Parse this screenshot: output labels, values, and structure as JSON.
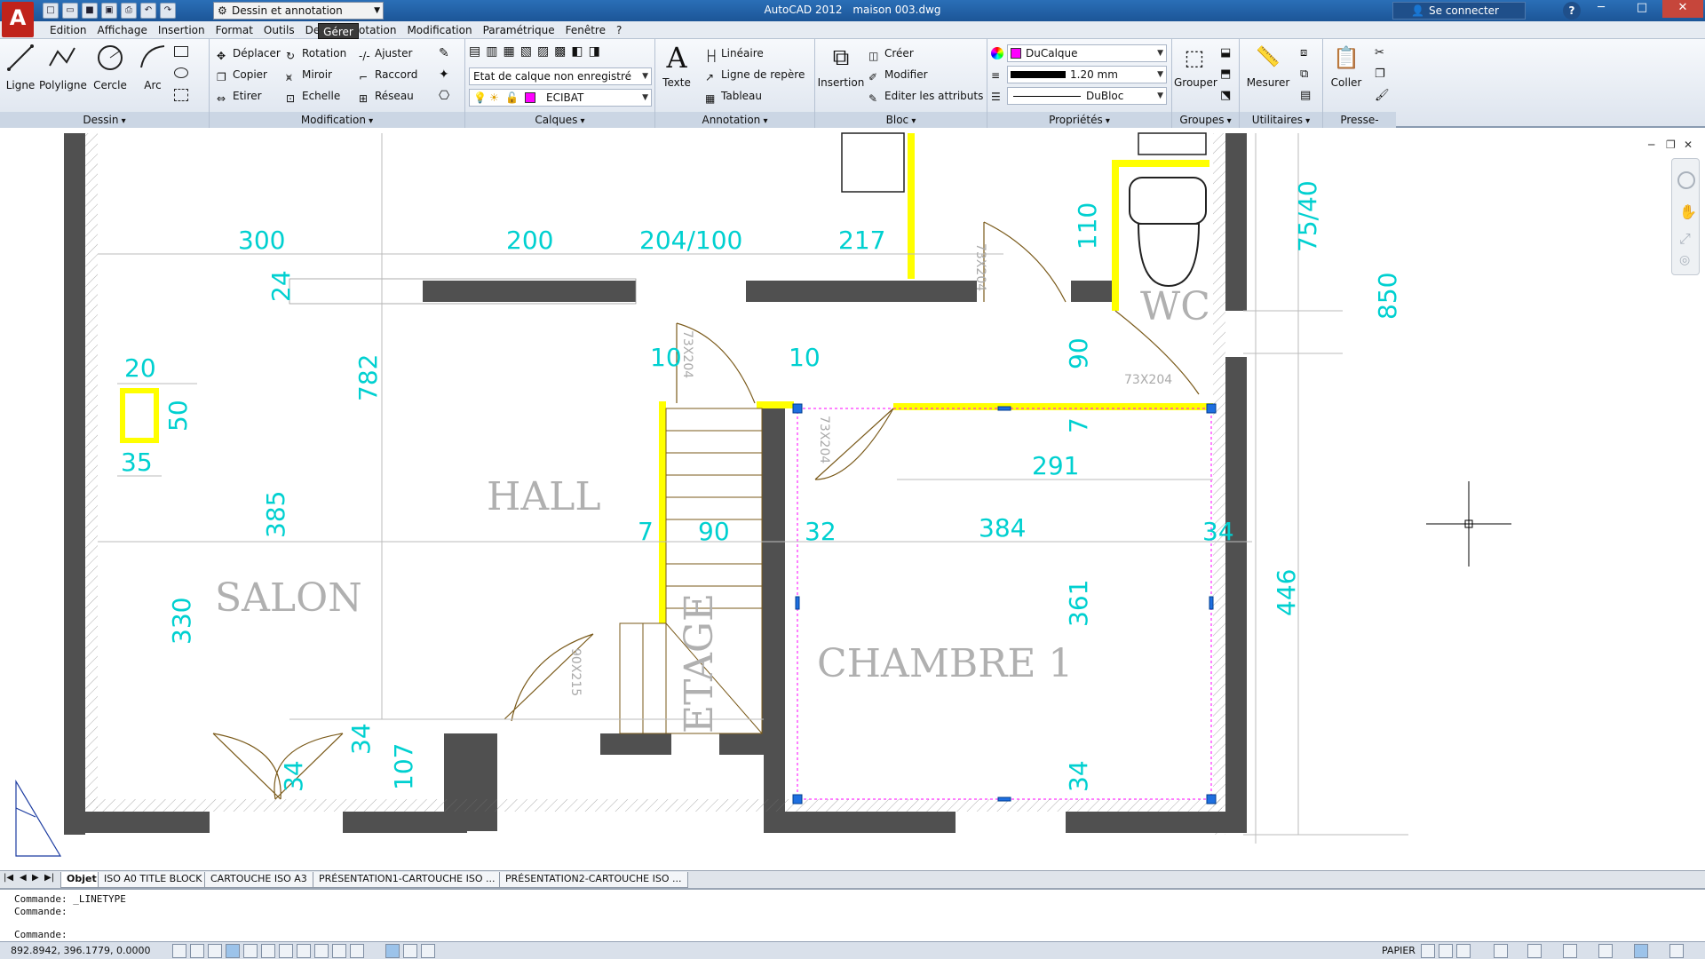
{
  "window": {
    "app_name": "AutoCAD 2012",
    "file_name": "maison 003.dwg",
    "workspace": "Dessin et annotation",
    "sign_in": "Se connecter",
    "help": "?",
    "controls": [
      "─",
      "□",
      "✕"
    ]
  },
  "menu": {
    "items": [
      "Edition",
      "Affichage",
      "Insertion",
      "Format",
      "Outils",
      "Dessin",
      "Cotation",
      "Modification",
      "Paramétrique",
      "Fenêtre",
      "?"
    ],
    "tooltip": "Gérer"
  },
  "ribbon": {
    "dessin": {
      "label": "Dessin",
      "ligne": "Ligne",
      "polyligne": "Polyligne",
      "cercle": "Cercle",
      "arc": "Arc"
    },
    "modification": {
      "label": "Modification",
      "deplacer": "Déplacer",
      "rotation": "Rotation",
      "ajuster": "Ajuster",
      "copier": "Copier",
      "miroir": "Miroir",
      "raccord": "Raccord",
      "etirer": "Etirer",
      "echelle": "Echelle",
      "reseau": "Réseau"
    },
    "calques": {
      "label": "Calques",
      "state": "Etat de calque non enregistré",
      "current": "ECIBAT"
    },
    "annotation": {
      "label": "Annotation",
      "texte": "Texte",
      "lineaire": "Linéaire",
      "repere": "Ligne de repère",
      "tableau": "Tableau"
    },
    "bloc": {
      "label": "Bloc",
      "insertion": "Insertion",
      "creer": "Créer",
      "modifier": "Modifier",
      "attributs": "Editer les attributs"
    },
    "proprietes": {
      "label": "Propriétés",
      "color": "DuCalque",
      "lineweight": "1.20 mm",
      "linetype": "DuBloc"
    },
    "groupes": {
      "label": "Groupes",
      "grouper": "Grouper"
    },
    "utilitaires": {
      "label": "Utilitaires",
      "mesurer": "Mesurer"
    },
    "presse": {
      "label": "Presse-papiers",
      "coller": "Coller"
    }
  },
  "drawing": {
    "rooms": {
      "salon": "SALON",
      "hall": "HALL",
      "wc": "WC",
      "chambre": "CHAMBRE 1",
      "etage": "ETAGE"
    },
    "dims": {
      "d300": "300",
      "d200": "200",
      "d204_100": "204/100",
      "d217": "217",
      "d110": "110",
      "d75_40": "75/40",
      "d850": "850",
      "d24": "24",
      "d20": "20",
      "d50": "50",
      "d35": "35",
      "d782": "782",
      "d10a": "10",
      "d10b": "10",
      "d90a": "90",
      "d7a": "7",
      "d291": "291",
      "d385": "385",
      "d7b": "7",
      "d90b": "90",
      "d32": "32",
      "d384": "384",
      "d34a": "34",
      "d446": "446",
      "d361": "361",
      "d330": "330",
      "d34b": "34",
      "d107": "107",
      "d34c": "34",
      "d34d": "34"
    },
    "doors": {
      "door1": "73X204",
      "door2": "73X204",
      "door3": "73X204",
      "door4": "73X204",
      "door5": "90X215"
    }
  },
  "layout_tabs": [
    "Objet",
    "ISO A0 TITLE BLOCK",
    "CARTOUCHE ISO A3",
    "PRÉSENTATION1-CARTOUCHE ISO ...",
    "PRÉSENTATION2-CARTOUCHE ISO ..."
  ],
  "command": {
    "line1": "Commande:  _LINETYPE",
    "line2": "Commande:",
    "line3": "Commande:"
  },
  "status": {
    "coords": "892.8942, 396.1779, 0.0000",
    "space": "PAPIER"
  },
  "colors": {
    "wall": "#505050",
    "dim": "#00d0d0",
    "highlight": "#ffff00",
    "door": "#7a5a1a",
    "grip": "#1e6fe0"
  }
}
